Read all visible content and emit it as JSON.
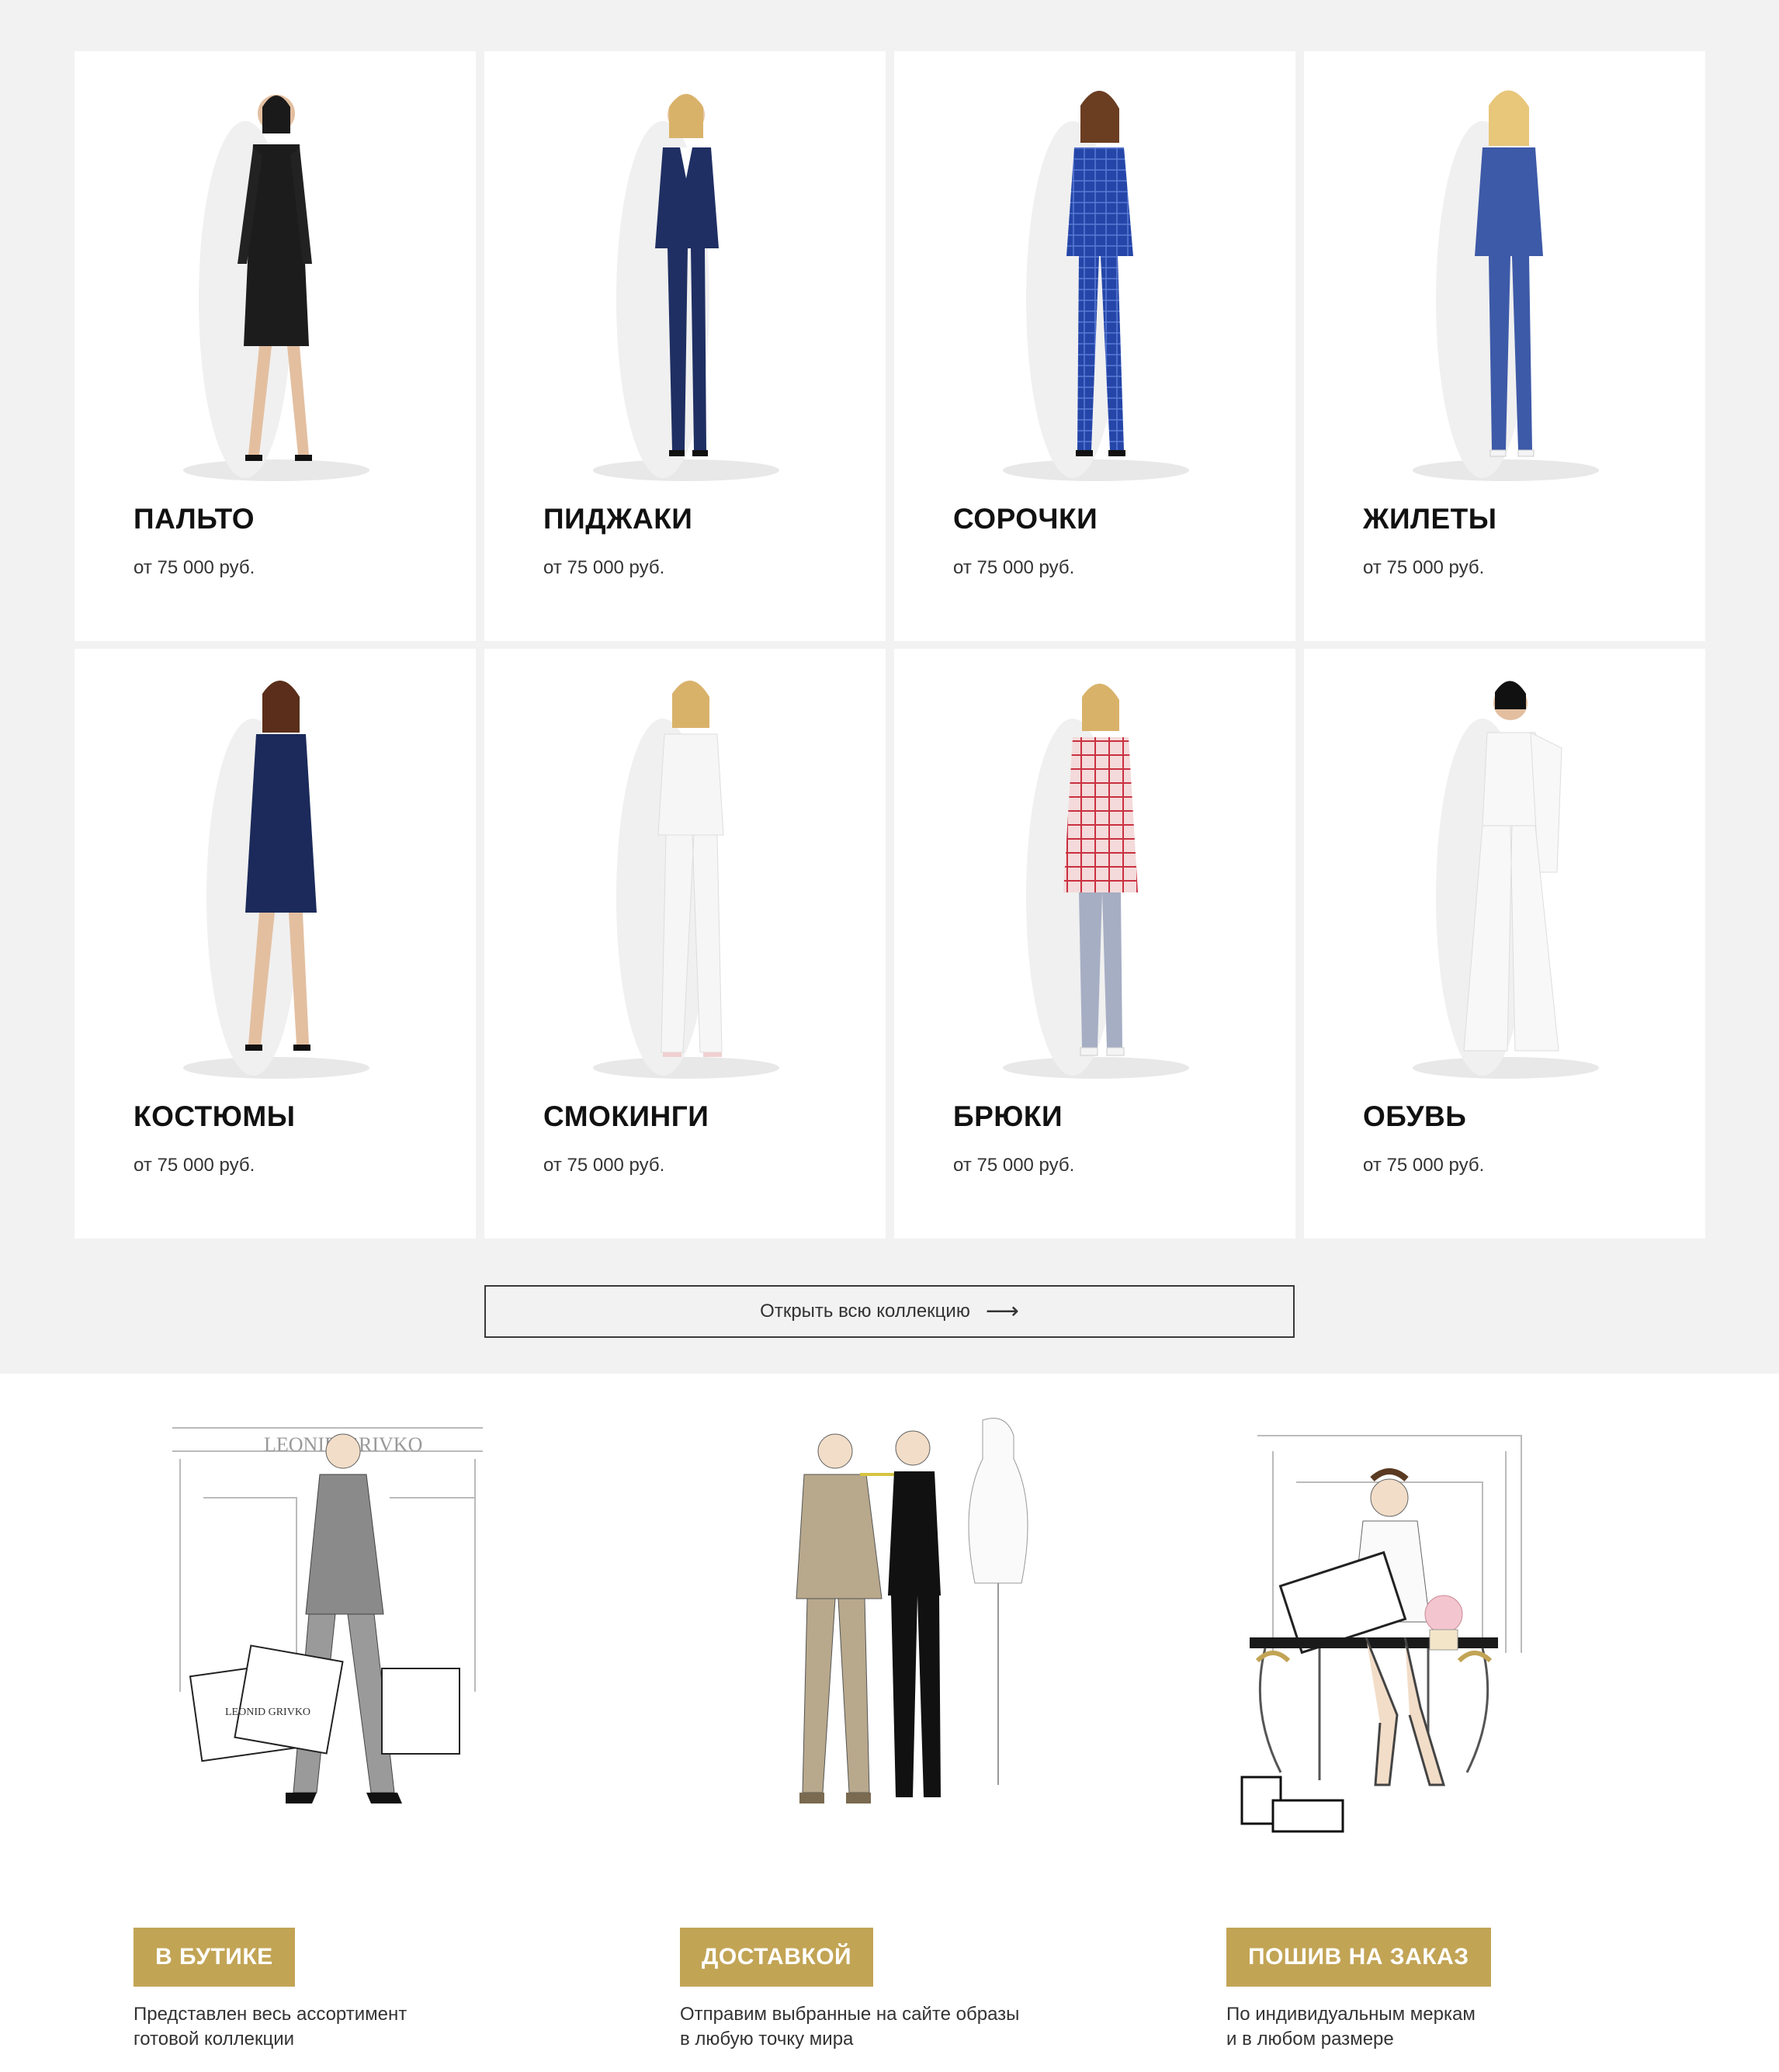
{
  "catalog": {
    "items": [
      {
        "title": "ПАЛЬТО",
        "price": "от 75 000 руб.",
        "outfit": "black-coat-dress"
      },
      {
        "title": "ПИДЖАКИ",
        "price": "от 75 000 руб.",
        "outfit": "navy-suit"
      },
      {
        "title": "СОРОЧКИ",
        "price": "от 75 000 руб.",
        "outfit": "blue-check-suit"
      },
      {
        "title": "ЖИЛЕТЫ",
        "price": "от 75 000 руб.",
        "outfit": "blue-suit"
      },
      {
        "title": "КОСТЮМЫ",
        "price": "от 75 000 руб.",
        "outfit": "navy-blazer-dress"
      },
      {
        "title": "СМОКИНГИ",
        "price": "от 75 000 руб.",
        "outfit": "white-tuxedo"
      },
      {
        "title": "БРЮКИ",
        "price": "от 75 000 руб.",
        "outfit": "red-check-blazer-grey-trousers"
      },
      {
        "title": "ОБУВЬ",
        "price": "от 75 000 руб.",
        "outfit": "white-wide-trousers"
      }
    ],
    "open_collection_label": "Открыть всю коллекцию",
    "open_collection_arrow": "⟶"
  },
  "services": [
    {
      "badge": "В БУТИКЕ",
      "desc_line1": "Представлен весь ассортимент",
      "desc_line2": "готовой коллекции",
      "illustration": "woman-with-shopping-bags-sketch",
      "sketch_text": "LEONID GRIVKO"
    },
    {
      "badge": "ДОСТАВКОЙ",
      "desc_line1": "Отправим выбранные на сайте образы",
      "desc_line2": "в любую точку мира",
      "illustration": "tailor-fitting-sketch"
    },
    {
      "badge": "ПОШИВ НА ЗАКАЗ",
      "desc_line1": "По индивидуальным меркам",
      "desc_line2": "и в любом размере",
      "illustration": "woman-at-table-with-gift-box-sketch"
    }
  ],
  "colors": {
    "accent_gold": "#c2a455",
    "catalog_bg": "#f2f2f2",
    "card_bg": "#ffffff"
  }
}
